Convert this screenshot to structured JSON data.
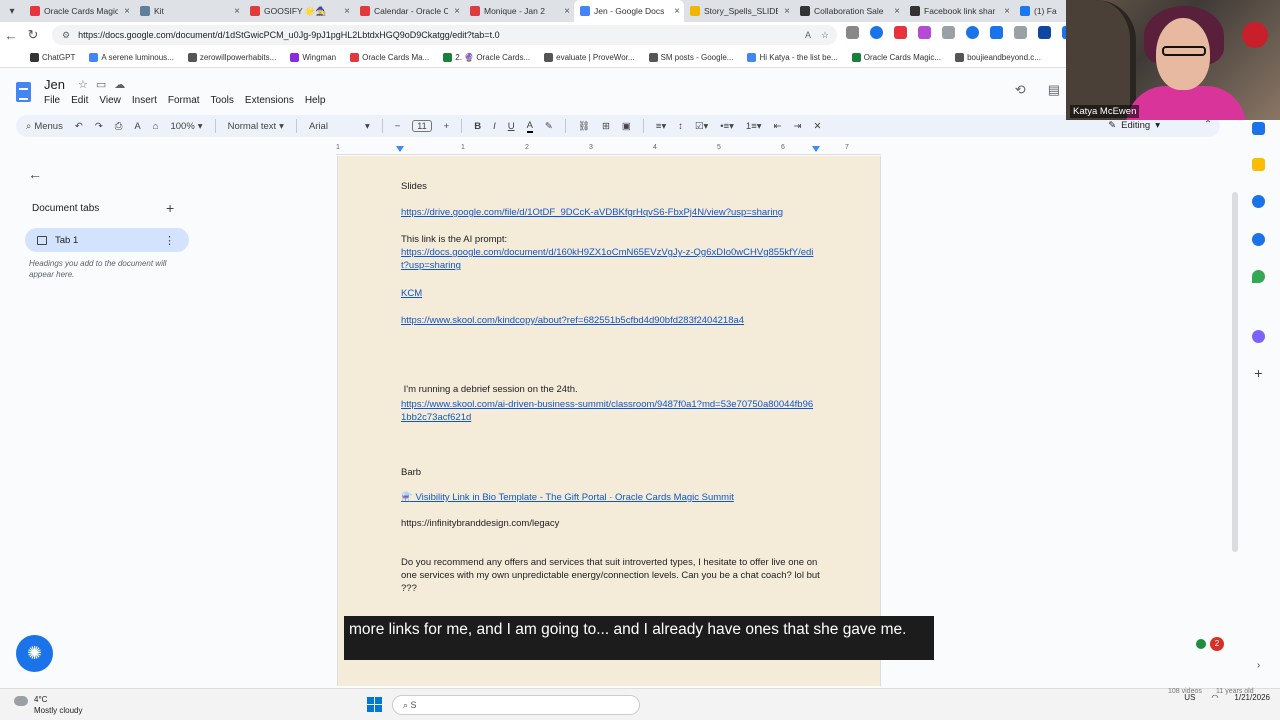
{
  "browser": {
    "tabs": [
      {
        "label": "Oracle Cards Magic",
        "color": "#e8333c",
        "active": false
      },
      {
        "label": "Kit",
        "color": "#5f7f9a",
        "active": false
      },
      {
        "label": "GOOSIFY 🌟🧙‍♀️",
        "color": "#e03a3a",
        "active": false
      },
      {
        "label": "Calendar - Oracle C",
        "color": "#e03a3a",
        "active": false
      },
      {
        "label": "Monique - Jan 2",
        "color": "#e03a3a",
        "active": false
      },
      {
        "label": "Jen - Google Docs",
        "color": "#4285f4",
        "active": true
      },
      {
        "label": "Story_Spells_SLIDE",
        "color": "#f4b400",
        "active": false
      },
      {
        "label": "Collaboration Sale",
        "color": "#333333",
        "active": false
      },
      {
        "label": "Facebook link shar",
        "color": "#333333",
        "active": false
      },
      {
        "label": "(1) Fa",
        "color": "#1877f2",
        "active": false
      }
    ],
    "url": "https://docs.google.com/document/d/1dStGwicPCM_u0Jg-9pJ1pgHL2LbtdxHGQ9oD9Ckatgg/edit?tab=t.0",
    "bookmarks": [
      {
        "label": "ChatGPT",
        "color": "#333333"
      },
      {
        "label": "A serene luminous...",
        "color": "#4285f4"
      },
      {
        "label": "zerowillpowerhabits...",
        "color": "#555555"
      },
      {
        "label": "Wingman",
        "color": "#8a2be2"
      },
      {
        "label": "Oracle Cards Ma...",
        "color": "#e03a3a"
      },
      {
        "label": "2. 🔮 Oracle Cards...",
        "color": "#188038"
      },
      {
        "label": "evaluate | ProveWor...",
        "color": "#555555"
      },
      {
        "label": "SM posts - Google...",
        "color": "#555555"
      },
      {
        "label": "Hi Katya - the list be...",
        "color": "#4285f4"
      },
      {
        "label": "Oracle Cards Magic...",
        "color": "#188038"
      },
      {
        "label": "boujieandbeyond.c...",
        "color": "#555555"
      }
    ]
  },
  "docs": {
    "title": "Jen",
    "menu": [
      "File",
      "Edit",
      "View",
      "Insert",
      "Format",
      "Tools",
      "Extensions",
      "Help"
    ],
    "toolbar": {
      "menus": "Menus",
      "zoom": "100%",
      "style": "Normal text",
      "font": "Arial",
      "font_size": "11",
      "mode": "Editing"
    },
    "sidebar": {
      "title": "Document tabs",
      "tab_label": "Tab 1",
      "hint": "Headings you add to the document will appear here."
    },
    "ruler": [
      "1",
      "1",
      "2",
      "3",
      "4",
      "5",
      "6",
      "7"
    ],
    "content": {
      "slides_label": "Slides",
      "slides_link": "https://drive.google.com/file/d/1OtDF_9DCcK-aVDBKfgrHqvS6-FbxPj4N/view?usp=sharing",
      "prompt_label": "This link is the AI prompt:",
      "prompt_link": "https://docs.google.com/document/d/160kH9ZX1oCmN65EVzVgJy-z-Qg6xDIo0wCHVg855kfY/edit?usp=sharing",
      "kcm_link": "KCM",
      "skool_link": "https://www.skool.com/kindcopy/about?ref=682551b5cfbd4d90bfd283f2404218a4",
      "debrief_text": " I'm running a debrief session on the 24th.",
      "summit_link": "https://www.skool.com/ai-driven-business-summit/classroom/9487f0a1?md=53e70750a80044fb961bb2c73acf621d",
      "barb_label": "Barb",
      "visibility_link": "⚗️  Visibility Link in Bio Template - The Gift Portal · Oracle Cards Magic Summit",
      "legacy_url": "https://infinitybranddesign.com/legacy",
      "question": "Do you recommend any offers and services that suit introverted types, I hesitate to offer live one on one services with my own unpredictable energy/connection levels. Can you be a chat coach? lol but ???"
    }
  },
  "video_overlay": {
    "participant_name": "Katya McEwen",
    "caption": "more links for me, and I am going to... and I already have ones that she gave me."
  },
  "notification_count": "2",
  "taskbar": {
    "temperature": "4°C",
    "weather": "Mostly cloudy",
    "search_placeholder": "S",
    "language": "US",
    "date": "1/21/2026",
    "videos_stat": "108 videos",
    "age_stat": "11 years old"
  }
}
